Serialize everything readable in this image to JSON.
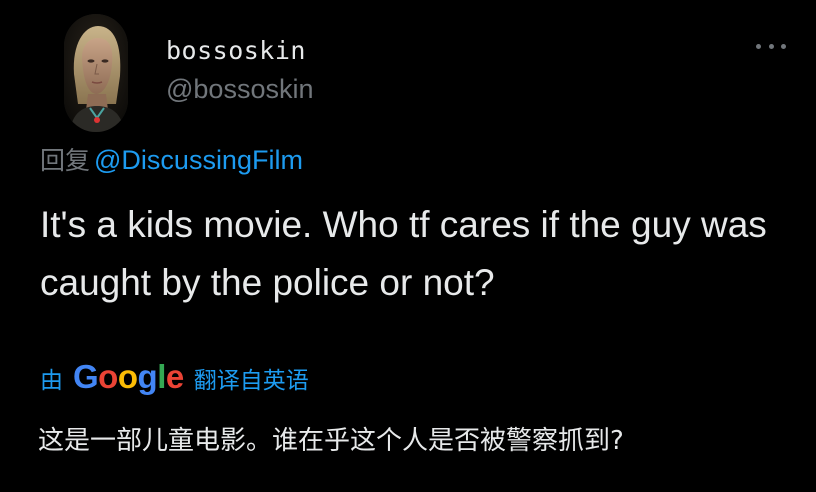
{
  "tweet": {
    "author": {
      "display_name": "bossoskin",
      "handle": "@bossoskin",
      "avatar_icon": "avatar-portrait"
    },
    "more_icon": "more-horizontal-icon",
    "reply": {
      "prefix": "回复",
      "mention": "@DiscussingFilm"
    },
    "text": "It's a kids movie. Who tf cares if the guy was caught by the police or not?",
    "translation": {
      "by": "由",
      "provider": "Google",
      "suffix": "翻译自英语",
      "text": "这是一部儿童电影。谁在乎这个人是否被警察抓到?"
    }
  },
  "colors": {
    "background": "#000000",
    "primary_text": "#e7e9ea",
    "secondary_text": "#71767b",
    "accent": "#1d9bf0",
    "google_blue": "#4285f4",
    "google_red": "#ea4335",
    "google_yellow": "#fbbc05",
    "google_green": "#34a853"
  }
}
